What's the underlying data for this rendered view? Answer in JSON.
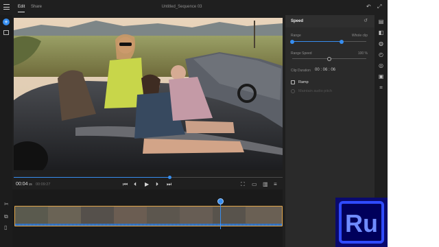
{
  "app": {
    "tabs": [
      {
        "label": "Edit",
        "active": true
      },
      {
        "label": "Share",
        "active": false
      }
    ],
    "sequence_title": "Untitled_Sequence 03"
  },
  "player": {
    "current_time": "00:04",
    "current_frames": "15",
    "total_time": "00:09:27",
    "progress": 0.58
  },
  "speed_panel": {
    "title": "Speed",
    "range_label": "Range",
    "range_value": "Whole clip",
    "range_start": 0.0,
    "range_end": 0.67,
    "range_speed_label": "Range Speed",
    "range_speed_value": "100 %",
    "range_speed_position": 0.5,
    "clip_duration_label": "Clip Duration",
    "clip_duration_value": "00 : 06 : 06",
    "ramp_label": "Ramp",
    "maintain_pitch_label": "Maintain audio pitch",
    "accent_color": "#378ef0"
  },
  "timeline": {
    "playhead_position": 0.77,
    "clip_border_color": "#e2a64a"
  },
  "logo": {
    "text": "Ru"
  }
}
